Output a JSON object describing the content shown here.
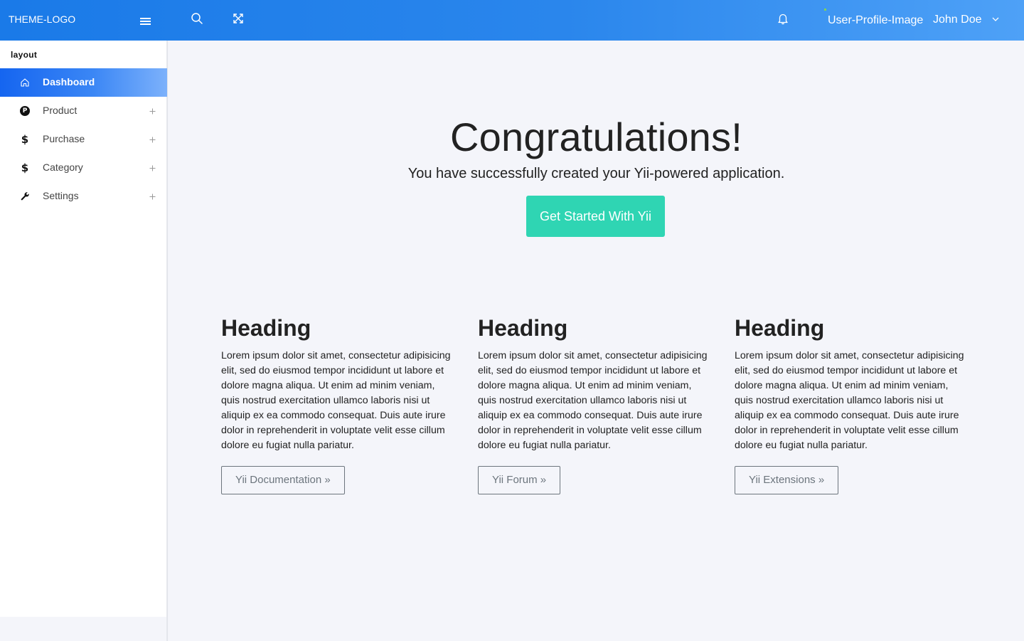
{
  "header": {
    "logo_alt": "THEME-LOGO",
    "profile_image_alt": "User-Profile-Image",
    "username": "John Doe",
    "icons": [
      "hamburger-menu-icon",
      "search-icon",
      "fullscreen-icon",
      "bell-icon",
      "chevron-down-icon"
    ]
  },
  "sidebar": {
    "section_label": "layout",
    "items": [
      {
        "label": "Dashboard",
        "icon": "home-icon",
        "active": true
      },
      {
        "label": "Product",
        "icon": "product-p-icon",
        "expandable": true
      },
      {
        "label": "Purchase",
        "icon": "dollar-icon",
        "expandable": true
      },
      {
        "label": "Category",
        "icon": "dollar-icon",
        "expandable": true
      },
      {
        "label": "Settings",
        "icon": "wrench-icon",
        "expandable": true
      }
    ]
  },
  "hero": {
    "title": "Congratulations!",
    "subtitle": "You have successfully created your Yii-powered application.",
    "cta_label": "Get Started With Yii"
  },
  "columns": [
    {
      "heading": "Heading",
      "body": "Lorem ipsum dolor sit amet, consectetur adipisicing elit, sed do eiusmod tempor incididunt ut labore et dolore magna aliqua. Ut enim ad minim veniam, quis nostrud exercitation ullamco laboris nisi ut aliquip ex ea commodo consequat. Duis aute irure dolor in reprehenderit in voluptate velit esse cillum dolore eu fugiat nulla pariatur.",
      "button": "Yii Documentation »"
    },
    {
      "heading": "Heading",
      "body": "Lorem ipsum dolor sit amet, consectetur adipisicing elit, sed do eiusmod tempor incididunt ut labore et dolore magna aliqua. Ut enim ad minim veniam, quis nostrud exercitation ullamco laboris nisi ut aliquip ex ea commodo consequat. Duis aute irure dolor in reprehenderit in voluptate velit esse cillum dolore eu fugiat nulla pariatur.",
      "button": "Yii Forum »"
    },
    {
      "heading": "Heading",
      "body": "Lorem ipsum dolor sit amet, consectetur adipisicing elit, sed do eiusmod tempor incididunt ut labore et dolore magna aliqua. Ut enim ad minim veniam, quis nostrud exercitation ullamco laboris nisi ut aliquip ex ea commodo consequat. Duis aute irure dolor in reprehenderit in voluptate velit esse cillum dolore eu fugiat nulla pariatur.",
      "button": "Yii Extensions »"
    }
  ],
  "colors": {
    "header_start": "#1a7ae8",
    "header_end": "#4ea1f7",
    "active_nav_start": "#1565f0",
    "cta": "#2fd5b3",
    "page_bg": "#f4f5fa"
  }
}
